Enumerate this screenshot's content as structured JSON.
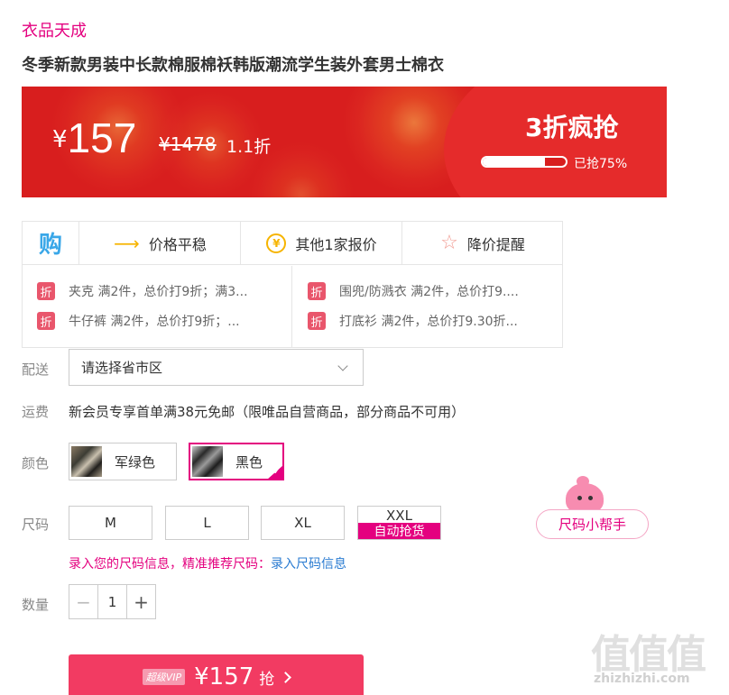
{
  "brand": "衣品天成",
  "product_title": "冬季新款男装中长款棉服棉袄韩版潮流学生装外套男士棉衣",
  "price_banner": {
    "currency": "¥",
    "price": "157",
    "original_price": "¥1478",
    "discount": "1.1折",
    "sale_tag": "3折疯抢",
    "sold_fraction": 0.75,
    "sold_text": "已抢75%"
  },
  "info": {
    "gou_icon": "购",
    "features": [
      {
        "icon": "arrow-right-icon",
        "label": "价格平稳"
      },
      {
        "icon": "yuan-coin-icon",
        "label": "其他1家报价"
      },
      {
        "icon": "star-icon",
        "label": "降价提醒"
      }
    ],
    "promo_tag": "折",
    "promos": [
      "夹克 满2件，总价打9折；满3...",
      "牛仔裤 满2件，总价打9折；...",
      "围兜/防溅衣 满2件，总价打9....",
      "打底衫 满2件，总价打9.30折..."
    ]
  },
  "delivery": {
    "label": "配送",
    "select_value": "请选择省市区"
  },
  "shipping": {
    "label": "运费",
    "text": "新会员专享首单满38元免邮（限唯品自营商品，部分商品不可用）"
  },
  "color": {
    "label": "颜色",
    "options": [
      {
        "name": "军绿色",
        "selected": false
      },
      {
        "name": "黑色",
        "selected": true
      }
    ]
  },
  "size": {
    "label": "尺码",
    "options": [
      "M",
      "L",
      "XL",
      "XXL"
    ],
    "auto_grab": "自动抢货",
    "helper": "尺码小帮手",
    "tip": "录入您的尺码信息，精准推荐尺码：",
    "tip_link": "录入尺码信息"
  },
  "quantity": {
    "label": "数量",
    "minus": "−",
    "value": "1",
    "plus": "+"
  },
  "buy_button": {
    "vip": "超级VIP",
    "price": "¥157",
    "label": "抢"
  },
  "watermark": {
    "logo": "值值值",
    "site": "zhizhizhi.com"
  },
  "colors": {
    "brand_pink": "#e4007f",
    "banner_red": "#d81e1e",
    "buy_red": "#f23b62",
    "link_blue": "#2a7bd1"
  }
}
